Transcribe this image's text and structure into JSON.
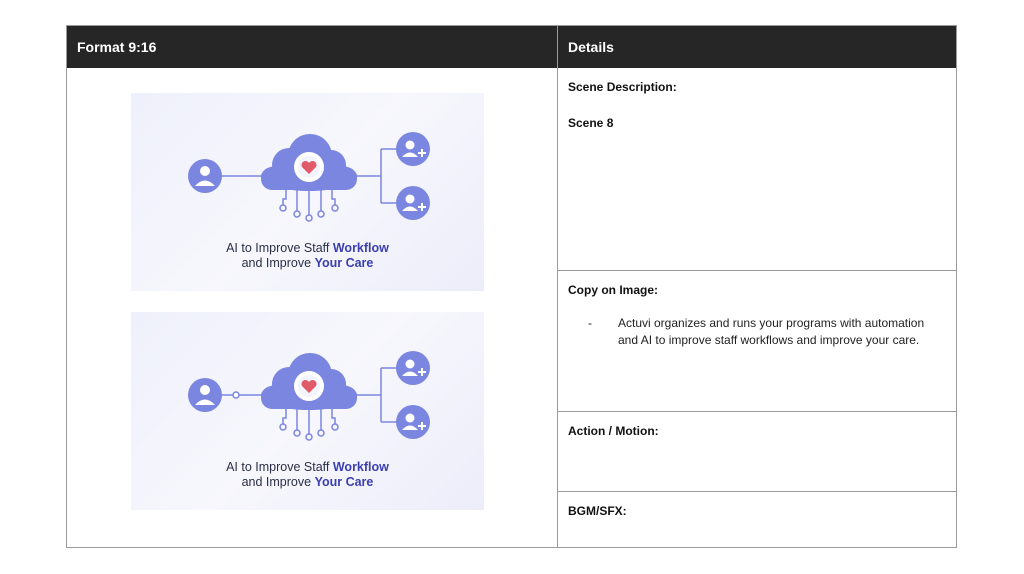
{
  "table": {
    "header_left": "Format 9:16",
    "header_right": "Details"
  },
  "thumbnails": [
    {
      "caption_line1_prefix": "AI to Improve  Staff ",
      "caption_line1_highlight": "Workflow",
      "caption_line2_prefix": "and Improve ",
      "caption_line2_highlight": "Your Care"
    },
    {
      "caption_line1_prefix": "AI to Improve  Staff ",
      "caption_line1_highlight": "Workflow",
      "caption_line2_prefix": "and Improve ",
      "caption_line2_highlight": "Your Care"
    }
  ],
  "details": {
    "scene_label": "Scene Description:",
    "scene_value": "Scene 8",
    "copy_label": "Copy on Image:",
    "copy_dash": "-",
    "copy_text": "Actuvi organizes and runs your programs with automation and AI to improve staff workflows and improve your care.",
    "action_label": "Action / Motion:",
    "bgm_label": "BGM/SFX:"
  },
  "colors": {
    "header_bg": "#262626",
    "accent_blue": "#7b86e0",
    "highlight_text": "#3b3fb0",
    "heart_red": "#e05a6a"
  },
  "icons": [
    "doctor-icon",
    "cloud-icon",
    "gear-icon",
    "heart-icon",
    "add-user-icon"
  ]
}
